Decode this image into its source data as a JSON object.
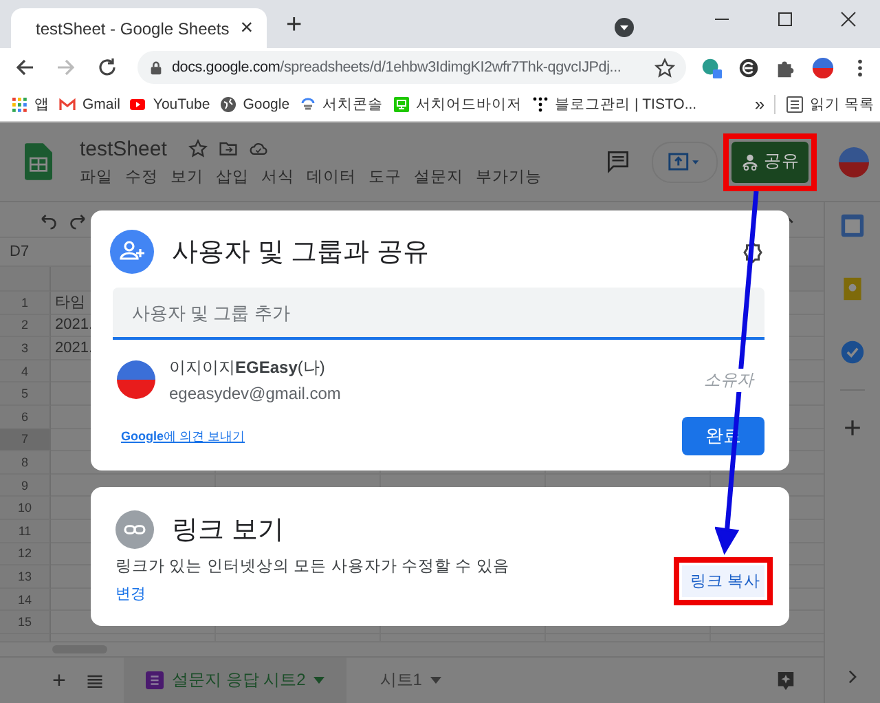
{
  "browser": {
    "tab": {
      "title": "testSheet - Google Sheets",
      "close": "×"
    },
    "new_tab": "+",
    "url": {
      "host": "docs.google.com",
      "path": "/spreadsheets/d/1ehbw3IdimgKI2wfr7Thk-qgvcIJPdj..."
    },
    "bookmarks": [
      {
        "label": "앱",
        "kind": "apps"
      },
      {
        "label": "Gmail",
        "kind": "gmail"
      },
      {
        "label": "YouTube",
        "kind": "youtube"
      },
      {
        "label": "Google",
        "kind": "globe"
      },
      {
        "label": "서치콘솔",
        "kind": "console"
      },
      {
        "label": "서치어드바이저",
        "kind": "monitor"
      },
      {
        "label": "블로그관리 | TISTO...",
        "kind": "dots"
      }
    ],
    "more": "»",
    "reading_list": "읽기 목록"
  },
  "doc": {
    "title": "testSheet",
    "menus": [
      "파일",
      "수정",
      "보기",
      "삽입",
      "서식",
      "데이터",
      "도구",
      "설문지",
      "부가기능"
    ],
    "share_button": "공유"
  },
  "sheet": {
    "name_box": "D7",
    "rows": [
      {
        "number": "1",
        "selected": false,
        "cell": "타임"
      },
      {
        "number": "2",
        "selected": false,
        "cell": "2021."
      },
      {
        "number": "3",
        "selected": false,
        "cell": "2021."
      },
      {
        "number": "4",
        "selected": false,
        "cell": ""
      },
      {
        "number": "5",
        "selected": false,
        "cell": ""
      },
      {
        "number": "6",
        "selected": false,
        "cell": ""
      },
      {
        "number": "7",
        "selected": true,
        "cell": ""
      },
      {
        "number": "8",
        "selected": false,
        "cell": ""
      },
      {
        "number": "9",
        "selected": false,
        "cell": ""
      },
      {
        "number": "10",
        "selected": false,
        "cell": ""
      },
      {
        "number": "11",
        "selected": false,
        "cell": ""
      },
      {
        "number": "12",
        "selected": false,
        "cell": ""
      },
      {
        "number": "13",
        "selected": false,
        "cell": ""
      },
      {
        "number": "14",
        "selected": false,
        "cell": ""
      },
      {
        "number": "15",
        "selected": false,
        "cell": ""
      }
    ]
  },
  "share_dialog": {
    "title": "사용자 및 그룹과 공유",
    "input_placeholder": "사용자 및 그룹 추가",
    "person": {
      "name": "이지이지**EGEasy**(나)",
      "email": "egeasydev@gmail.com",
      "role": "소유자"
    },
    "feedback_link": "**Google**에 의견 보내기",
    "done_button": "완료"
  },
  "link_dialog": {
    "title": "링크 보기",
    "description": "링크가 있는 인터넷상의 모든 사용자가 수정할 수 있음",
    "change_link": "변경",
    "copy_button": "링크 복사"
  },
  "add_sheet": "+",
  "sheet_tabs": [
    {
      "label": "설문지 응답 시트2",
      "selected": true,
      "kind": "form"
    },
    {
      "label": "시트1",
      "selected": false,
      "kind": "plain"
    }
  ]
}
